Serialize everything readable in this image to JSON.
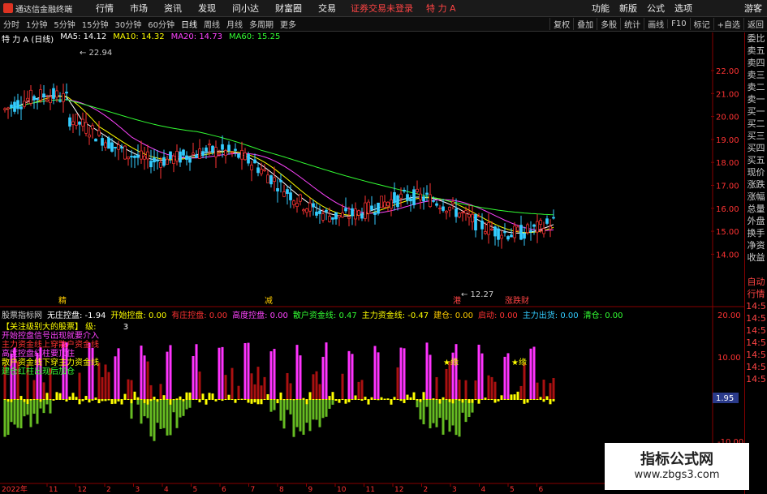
{
  "menubar": {
    "app_title": "通达信金融终端",
    "items": [
      "行情",
      "市场",
      "资讯",
      "发现",
      "问小达",
      "财富圈",
      "交易"
    ],
    "warning": "证券交易未登录",
    "stock": "特 力 A",
    "right": [
      "功能",
      "新版",
      "公式",
      "选项"
    ],
    "guest": "游客"
  },
  "toolbar": {
    "periods": [
      "分时",
      "1分钟",
      "5分钟",
      "15分钟",
      "30分钟",
      "60分钟",
      "日线",
      "周线",
      "月线",
      "多周期",
      "更多"
    ],
    "active": "日线",
    "right": [
      "复权",
      "叠加",
      "多股",
      "统计",
      "画线",
      "F10",
      "标记",
      "+自选",
      "返回"
    ]
  },
  "price_info": {
    "name": "特 力 A (日线)",
    "ma5": "MA5: 14.12",
    "ma10": "MA10: 14.32",
    "ma20": "MA20: 14.73",
    "ma60": "MA60: 15.25",
    "high_label": "22.94",
    "low_label": "12.27",
    "y_ticks": [
      "22.00",
      "21.00",
      "20.00",
      "19.00",
      "18.00",
      "17.00",
      "16.00",
      "15.00",
      "14.00"
    ],
    "markers": [
      {
        "text": "精",
        "color": "#ffcc00"
      },
      {
        "text": "减",
        "color": "#ffcc00"
      },
      {
        "text": "港",
        "color": "#ff4444"
      },
      {
        "text": "涨跌财",
        "color": "#ff4444"
      }
    ]
  },
  "indicator": {
    "name": "股票指标网",
    "fields": [
      {
        "label": "无庄控盘: -1.94",
        "color": "#ffffff"
      },
      {
        "label": "开始控盘: 0.00",
        "color": "#ffff00"
      },
      {
        "label": "有庄控盘: 0.00",
        "color": "#ff3333"
      },
      {
        "label": "高度控盘: 0.00",
        "color": "#ff44ff"
      },
      {
        "label": "散户资金线: 0.47",
        "color": "#33ff33"
      },
      {
        "label": "主力资金线: -0.47",
        "color": "#ffff00"
      },
      {
        "label": "建仓: 0.00",
        "color": "#ffcc00"
      },
      {
        "label": "启动: 0.00",
        "color": "#ff3333"
      },
      {
        "label": "主力出货: 0.00",
        "color": "#33ccff"
      },
      {
        "label": "清仓: 0.00",
        "color": "#33ff33"
      }
    ],
    "level_label": "【关注级别大的股票】  级:",
    "level_value": "3",
    "legend": [
      {
        "text": "开始控盘信号出现就要介入",
        "color": "#ff44ff"
      },
      {
        "text": "主力资金线上穿散户资金线",
        "color": "#ff3333"
      },
      {
        "text": "高度控盘红柱要顶住",
        "color": "#ff44ff"
      },
      {
        "text": "散户资金线下穿主力资金线",
        "color": "#ffff00"
      },
      {
        "text": "建仓红柱出现后加仓",
        "color": "#33ff33"
      }
    ],
    "y_ticks": [
      "20.00",
      "10.00",
      "-10.00"
    ],
    "current": "1.95",
    "star_labels": [
      "★缘",
      "★缘"
    ]
  },
  "xaxis": {
    "year": "2022年",
    "months": [
      "11",
      "12",
      "2",
      "3",
      "4",
      "5",
      "6",
      "7",
      "8",
      "9",
      "10",
      "11",
      "12",
      "2",
      "3",
      "4",
      "5",
      "6"
    ]
  },
  "right_panel": {
    "items": [
      "委比",
      "卖五",
      "卖四",
      "卖三",
      "卖二",
      "卖一",
      "买一",
      "买二",
      "买三",
      "买四",
      "买五",
      "现价",
      "涨跌",
      "涨幅",
      "总量",
      "外盘",
      "换手",
      "净资",
      "收益",
      "",
      "自动",
      "行情",
      "14:5",
      "14:5",
      "14:5",
      "14:5",
      "14:5",
      "14:5",
      "14:5"
    ]
  },
  "watermark": {
    "title": "指标公式网",
    "url": "www.zbgs3.com"
  },
  "colors": {
    "up": "#ff3333",
    "down": "#33ccff",
    "ma5": "#ffffff",
    "ma10": "#ffff00",
    "ma20": "#ff44ff",
    "ma60": "#33ff33"
  }
}
